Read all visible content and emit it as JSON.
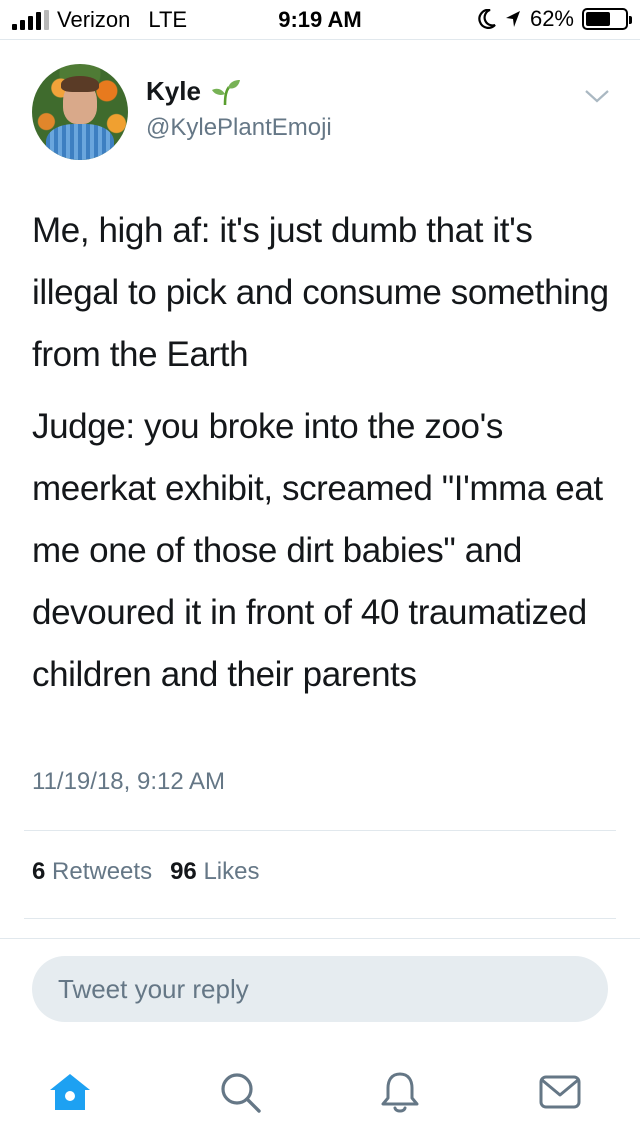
{
  "status_bar": {
    "carrier": "Verizon",
    "network": "LTE",
    "time": "9:19 AM",
    "battery_percent": "62%",
    "battery_level": 0.62,
    "icons": [
      "signal-bars-icon",
      "moon-icon",
      "location-arrow-icon",
      "battery-icon"
    ]
  },
  "tweet": {
    "display_name": "Kyle",
    "name_emoji": "sprout-icon",
    "handle": "@KylePlantEmoji",
    "paragraphs": [
      "Me, high af: it's just dumb that it's illegal to pick and consume something from the Earth",
      "Judge: you broke into the zoo's meerkat exhibit, screamed \"I'mma eat me one of those dirt babies\" and devoured it in front of 40 traumatized children and their parents"
    ],
    "timestamp": "11/19/18, 9:12 AM",
    "retweets_count": "6",
    "retweets_label": "Retweets",
    "likes_count": "96",
    "likes_label": "Likes"
  },
  "reply": {
    "placeholder": "Tweet your reply"
  },
  "tab_bar": {
    "tabs": [
      "home-icon",
      "search-icon",
      "notifications-icon",
      "messages-icon"
    ],
    "active_color": "#1da1f2",
    "inactive_color": "#657786"
  }
}
